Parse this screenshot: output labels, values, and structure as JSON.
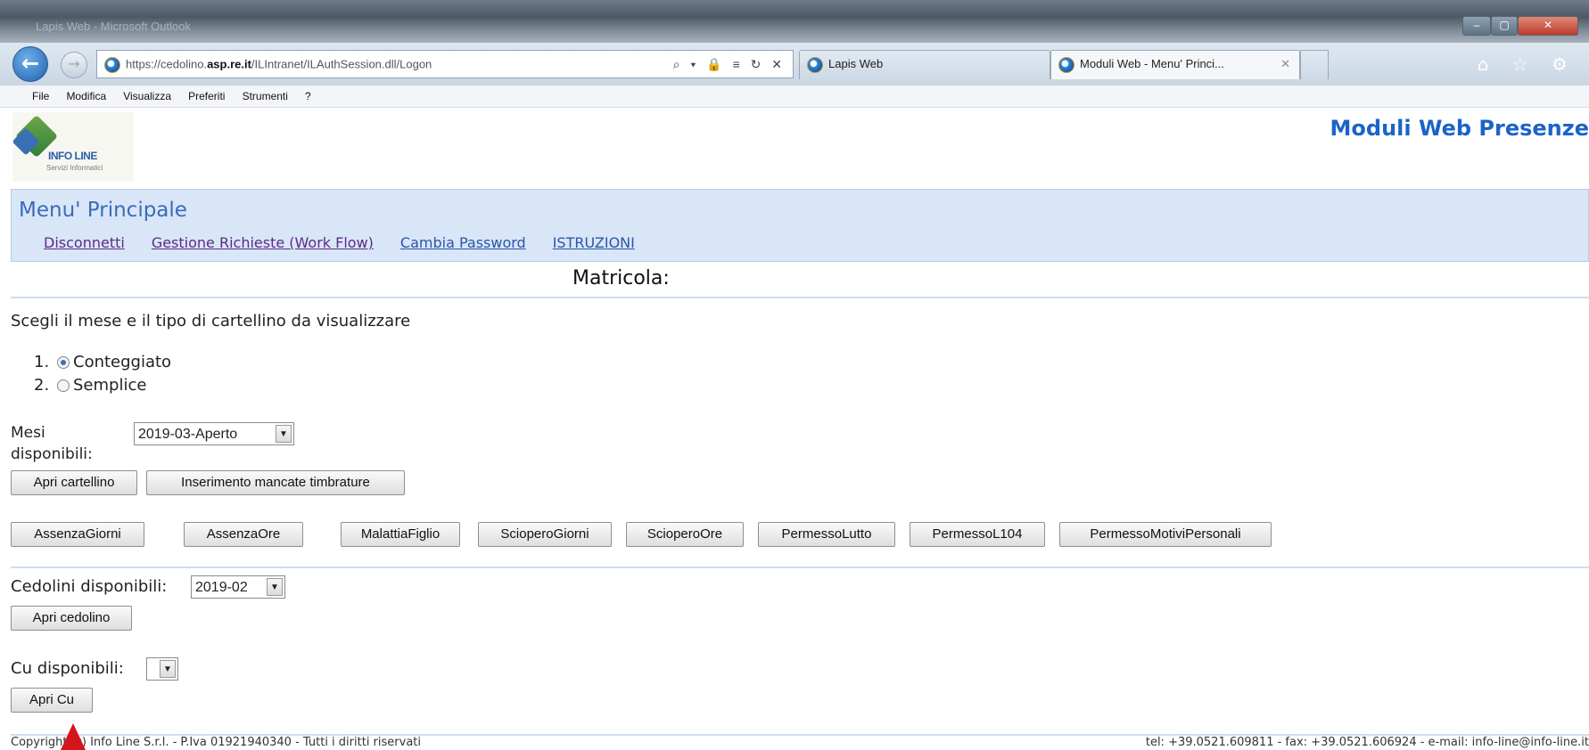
{
  "browser": {
    "window_title": "Lapis Web - Microsoft Outlook",
    "address_prefix": "https://cedolino.",
    "address_domain": "asp.re.it",
    "address_path": "/ILIntranet/ILAuthSession.dll/Logon",
    "address_icons": "⌕ ▾ 🔒 ≡ ↻ ✕",
    "tabs": [
      {
        "label": "Lapis Web"
      },
      {
        "label": "Moduli Web - Menu' Princi...",
        "close": "✕"
      }
    ],
    "menu": [
      "File",
      "Modifica",
      "Visualizza",
      "Preferiti",
      "Strumenti",
      "?"
    ],
    "toolbar_icons": "⌂ ☆ ⚙",
    "window_controls": {
      "minimize": "–",
      "maximize": "▢",
      "close": "✕"
    }
  },
  "header": {
    "logo_text": "INFO LINE",
    "logo_sub": "Servizi Informatici",
    "app_title": "Moduli Web Presenze"
  },
  "menu_panel": {
    "title": "Menu' Principale",
    "links": [
      "Disconnetti",
      "Gestione Richieste (Work Flow)",
      "Cambia Password",
      "ISTRUZIONI"
    ]
  },
  "matricola_label": "Matricola:",
  "form": {
    "prompt": "Scegli il mese e il tipo di cartellino da visualizzare",
    "options": [
      {
        "num": "1.",
        "label": "Conteggiato",
        "checked": true
      },
      {
        "num": "2.",
        "label": "Semplice",
        "checked": false
      }
    ],
    "mesi_label": "Mesi disponibili:",
    "mesi_value": "2019-03-Aperto",
    "apri_cartellino": "Apri cartellino",
    "mancate_timbrature": "Inserimento mancate timbrature",
    "request_buttons": [
      "AssenzaGiorni",
      "AssenzaOre",
      "MalattiaFiglio",
      "ScioperoGiorni",
      "ScioperoOre",
      "PermessoLutto",
      "PermessoL104",
      "PermessoMotiviPersonali"
    ],
    "cedolini_label": "Cedolini disponibili:",
    "cedolini_value": "2019-02",
    "apri_cedolino": "Apri cedolino",
    "cu_label": "Cu disponibili:",
    "cu_value": "",
    "apri_cu": "Apri Cu"
  },
  "footer": {
    "left": "Copyright (c) Info Line S.r.l. - P.Iva 01921940340 - Tutti i diritti riservati",
    "right": "tel: +39.0521.609811 - fax: +39.0521.606924 - e-mail: info-line@info-line.it"
  },
  "colors": {
    "accent": "#1b64c9",
    "menu_panel_bg": "#d9e6f8",
    "link": "#5a2c82",
    "cursor": "#d3151c"
  },
  "select_arrow_icon": "▼",
  "back_icon": "←",
  "forward_icon": "→"
}
